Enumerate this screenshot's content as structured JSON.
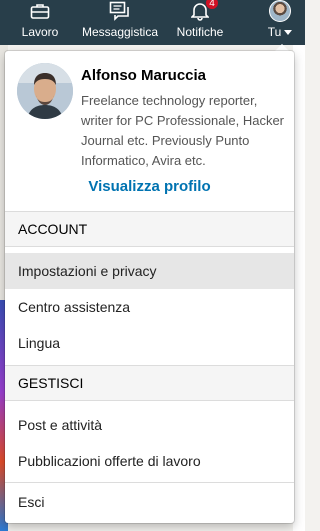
{
  "topbar": {
    "items": [
      {
        "label": "Lavoro",
        "icon": "briefcase-icon"
      },
      {
        "label": "Messaggistica",
        "icon": "messaging-icon"
      },
      {
        "label": "Notifiche",
        "icon": "bell-icon",
        "badge": "4"
      },
      {
        "label": "Tu",
        "icon": "avatar"
      }
    ]
  },
  "profile": {
    "name": "Alfonso Maruccia",
    "headline": "Freelance technology reporter, writer for PC Professionale, Hacker Journal etc. Previously Punto Informatico, Avira etc.",
    "view_profile": "Visualizza profilo"
  },
  "account": {
    "heading": "ACCOUNT",
    "items": [
      "Impostazioni e privacy",
      "Centro assistenza",
      "Lingua"
    ]
  },
  "manage": {
    "heading": "GESTISCI",
    "items": [
      "Post e attività",
      "Pubblicazioni offerte di lavoro"
    ]
  },
  "signout": "Esci",
  "colors": {
    "nav_bg": "#283e4a",
    "link": "#0073b1",
    "badge": "#d11124",
    "hover": "#e6e6e6"
  }
}
